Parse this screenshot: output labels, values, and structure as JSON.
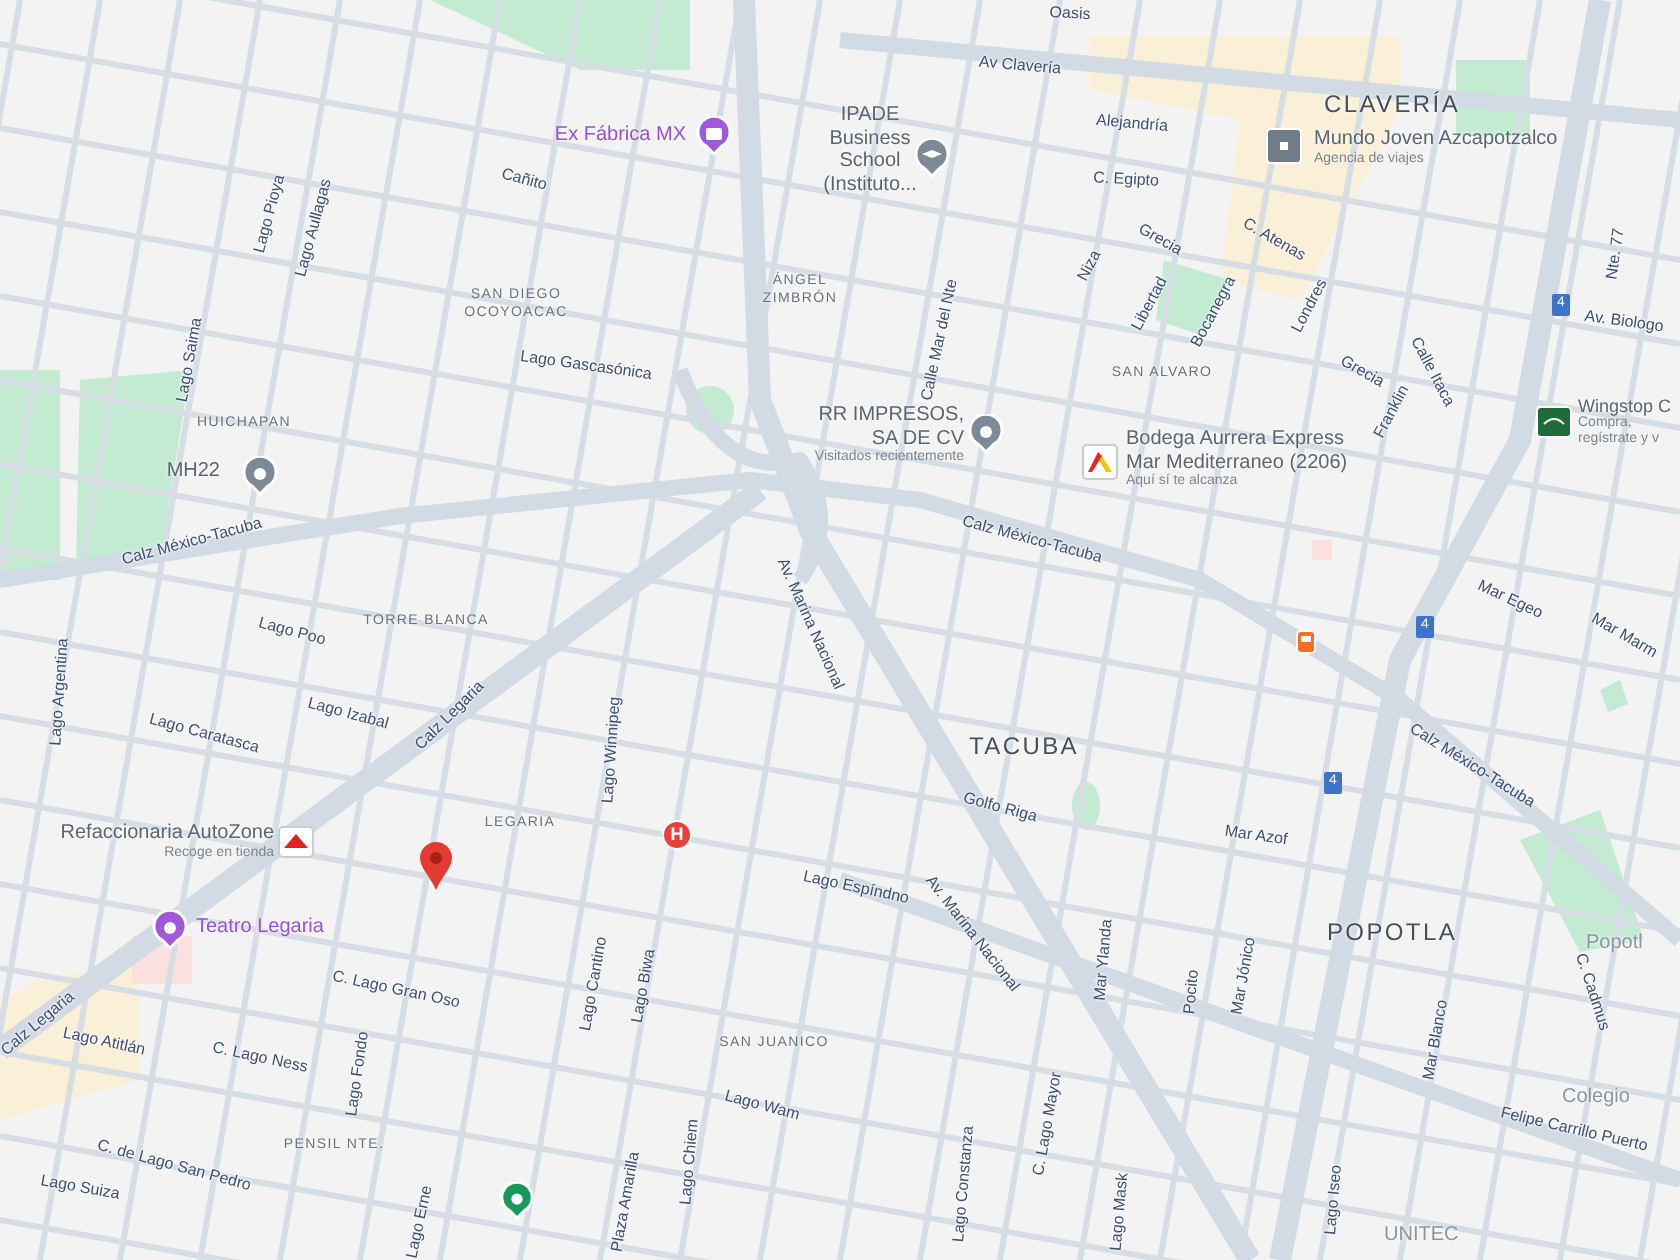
{
  "map": {
    "neighborhoods": [
      {
        "name": "CLAVERÍA",
        "kind": "major"
      },
      {
        "name": "TACUBA",
        "kind": "major"
      },
      {
        "name": "POPOTLA",
        "kind": "major"
      },
      {
        "name": "SAN DIEGO",
        "kind": "minor"
      },
      {
        "name": "OCOYOACAC",
        "kind": "minor"
      },
      {
        "name": "ÁNGEL",
        "kind": "minor"
      },
      {
        "name": "ZIMBRÓN",
        "kind": "minor"
      },
      {
        "name": "HUICHAPAN",
        "kind": "minor"
      },
      {
        "name": "TORRE BLANCA",
        "kind": "minor"
      },
      {
        "name": "SAN ALVARO",
        "kind": "minor"
      },
      {
        "name": "LEGARIA",
        "kind": "minor"
      },
      {
        "name": "SAN JUANICO",
        "kind": "minor"
      },
      {
        "name": "PENSIL NTE.",
        "kind": "minor"
      }
    ],
    "streets": [
      {
        "name": "Oasis"
      },
      {
        "name": "Av Clavería"
      },
      {
        "name": "Alejandría"
      },
      {
        "name": "C. Egipto"
      },
      {
        "name": "Grecia"
      },
      {
        "name": "C. Atenas"
      },
      {
        "name": "Niza"
      },
      {
        "name": "Libertad"
      },
      {
        "name": "Bocanegra"
      },
      {
        "name": "Londres"
      },
      {
        "name": "Grecia"
      },
      {
        "name": "Calle Itaca"
      },
      {
        "name": "Franklin"
      },
      {
        "name": "Calle Mar del Nte"
      },
      {
        "name": "Nte. 77"
      },
      {
        "name": "Av. Biologo"
      },
      {
        "name": "Cañito"
      },
      {
        "name": "Lago Pioya"
      },
      {
        "name": "Lago Aullagas"
      },
      {
        "name": "Lago Saima"
      },
      {
        "name": "Lago Gascasónica"
      },
      {
        "name": "Calz México-Tacuba"
      },
      {
        "name": "Calz México-Tacuba"
      },
      {
        "name": "Calz México-Tacuba"
      },
      {
        "name": "Lago Poo"
      },
      {
        "name": "Lago Izabal"
      },
      {
        "name": "Lago Caratasca"
      },
      {
        "name": "Lago Argentina"
      },
      {
        "name": "Calz Legaria"
      },
      {
        "name": "Av. Marina Nacional"
      },
      {
        "name": "Lago Winnipeg"
      },
      {
        "name": "Golfo Riga"
      },
      {
        "name": "Mar Azof"
      },
      {
        "name": "Lago Espíndno"
      },
      {
        "name": "Av. Marina Nacional"
      },
      {
        "name": "Mar Egeo"
      },
      {
        "name": "Mar Marm"
      },
      {
        "name": "Mar Ylanda"
      },
      {
        "name": "Pocito"
      },
      {
        "name": "Mar Jónico"
      },
      {
        "name": "Mar Blanco"
      },
      {
        "name": "C. Cadmus"
      },
      {
        "name": "Felipe Carrillo Puerto"
      },
      {
        "name": "C. Lago Gran Oso"
      },
      {
        "name": "Lago Cantino"
      },
      {
        "name": "Lago Biwa"
      },
      {
        "name": "Lago Atitlán"
      },
      {
        "name": "C. Lago Ness"
      },
      {
        "name": "Lago Fondo"
      },
      {
        "name": "Lago Wam"
      },
      {
        "name": "Lago Chiem"
      },
      {
        "name": "C. de Lago San Pedro"
      },
      {
        "name": "Lago Suiza"
      },
      {
        "name": "Lago Mask"
      },
      {
        "name": "C. Lago Mayor"
      },
      {
        "name": "Lago Constanza"
      },
      {
        "name": "Lago Iseo"
      },
      {
        "name": "Lago Erne"
      },
      {
        "name": "Plaza Amarilla"
      },
      {
        "name": "Calz Legaria"
      }
    ],
    "places": [
      {
        "kind": "attraction",
        "name_lines": [
          "Ex Fábrica MX"
        ]
      },
      {
        "kind": "school",
        "name_lines": [
          "IPADE",
          "Business",
          "School",
          "(Instituto..."
        ]
      },
      {
        "kind": "pin",
        "name_lines": [
          "MH22"
        ]
      },
      {
        "kind": "pin",
        "name_lines": [
          "RR IMPRESOS,",
          "SA DE CV"
        ],
        "subtitle": "Visitados recientemente"
      },
      {
        "kind": "store",
        "name_lines": [
          "Bodega Aurrera Express",
          "Mar Mediterraneo (2206)"
        ],
        "subtitle": "Aquí sí te alcanza"
      },
      {
        "kind": "agency",
        "name_lines": [
          "Mundo Joven Azcapotzalco"
        ],
        "subtitle": "Agencia de viajes"
      },
      {
        "kind": "restaurant",
        "name_lines": [
          "Wingstop C"
        ],
        "subtitle_lines": [
          "Compra,",
          "regístrate y v"
        ]
      },
      {
        "kind": "autoparts",
        "name_lines": [
          "Refaccionaria AutoZone"
        ],
        "subtitle": "Recoge en tienda"
      },
      {
        "kind": "theater",
        "name_lines": [
          "Teatro Legaria"
        ]
      },
      {
        "kind": "label",
        "name_lines": [
          "Popotl"
        ]
      },
      {
        "kind": "label",
        "name_lines": [
          "Colegio"
        ]
      },
      {
        "kind": "label",
        "name_lines": [
          "UNITEC"
        ]
      }
    ],
    "route_shields": [
      {
        "number": "4"
      },
      {
        "number": "4"
      },
      {
        "number": "4"
      }
    ],
    "hospital_marker": {
      "label": "H"
    }
  }
}
